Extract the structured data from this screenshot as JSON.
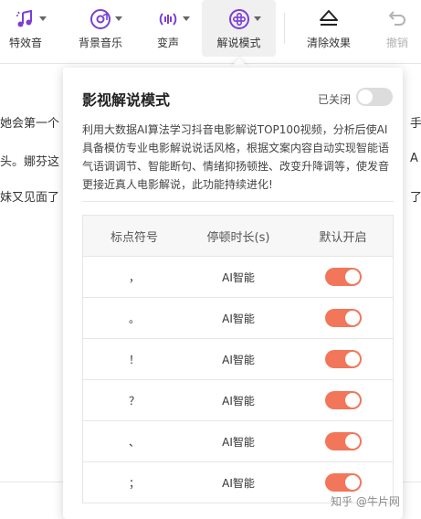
{
  "toolbar": {
    "items": [
      {
        "label": "特效音",
        "icon": "sound-effect-icon"
      },
      {
        "label": "背景音乐",
        "icon": "music-disc-icon"
      },
      {
        "label": "变声",
        "icon": "voice-change-icon"
      },
      {
        "label": "解说模式",
        "icon": "narration-mode-icon"
      },
      {
        "label": "清除效果",
        "icon": "eraser-icon"
      },
      {
        "label": "撤销",
        "icon": "undo-icon"
      }
    ],
    "accent": "#7b3fd6"
  },
  "background_text": {
    "line1": "她会第一个",
    "line2": "头。娜芬这",
    "line3": "妹又见面了",
    "right1": "手",
    "right2": "A",
    "right3": "了"
  },
  "panel": {
    "title": "影视解说模式",
    "status": "已关闭",
    "description": "利用大数据AI算法学习抖音电影解说TOP100视频，分析后使AI具备模仿专业电影解说说话风格，根据文案内容自动实现智能语气语调调节、智能断句、情绪抑扬顿挫、改变升降调等，使发音更接近真人电影解说，此功能持续进化!",
    "table": {
      "headers": [
        "标点符号",
        "停顿时长(s)",
        "默认开启"
      ],
      "rows": [
        {
          "symbol": "，",
          "duration": "AI智能",
          "on": true
        },
        {
          "symbol": "。",
          "duration": "AI智能",
          "on": true
        },
        {
          "symbol": "！",
          "duration": "AI智能",
          "on": true
        },
        {
          "symbol": "？",
          "duration": "AI智能",
          "on": true
        },
        {
          "symbol": "、",
          "duration": "AI智能",
          "on": true
        },
        {
          "symbol": "；",
          "duration": "AI智能",
          "on": true
        }
      ]
    },
    "toggle_on_color": "#f2765a"
  },
  "watermark": "知乎 @牛片网"
}
